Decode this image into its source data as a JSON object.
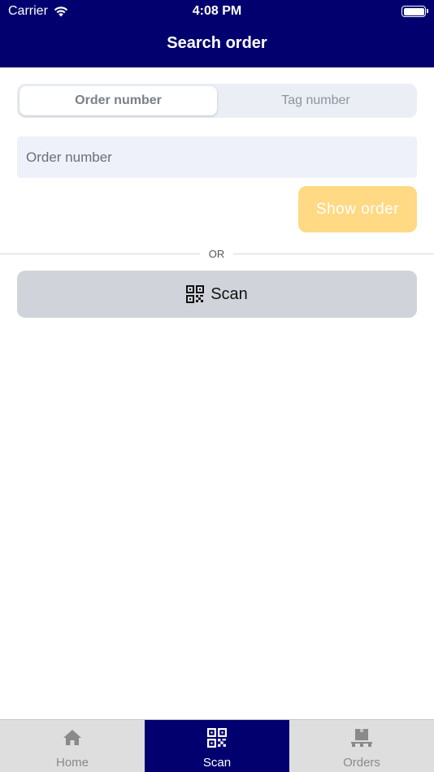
{
  "status_bar": {
    "carrier": "Carrier",
    "time": "4:08 PM"
  },
  "nav": {
    "title": "Search order"
  },
  "segmented": {
    "options": [
      {
        "label": "Order number",
        "active": true
      },
      {
        "label": "Tag number",
        "active": false
      }
    ]
  },
  "search": {
    "placeholder": "Order number",
    "value": ""
  },
  "show_order": {
    "label": "Show order"
  },
  "divider": {
    "label": "OR"
  },
  "scan": {
    "label": "Scan",
    "icon": "qr-code-icon"
  },
  "tabbar": {
    "tabs": [
      {
        "label": "Home",
        "icon": "home-icon",
        "active": false
      },
      {
        "label": "Scan",
        "icon": "qr-code-icon",
        "active": true
      },
      {
        "label": "Orders",
        "icon": "orders-icon",
        "active": false
      }
    ]
  },
  "colors": {
    "primary": "#02006e",
    "accent_disabled": "#ffd983",
    "scan_button": "#d0d4da",
    "input_bg": "#eef1f9"
  }
}
